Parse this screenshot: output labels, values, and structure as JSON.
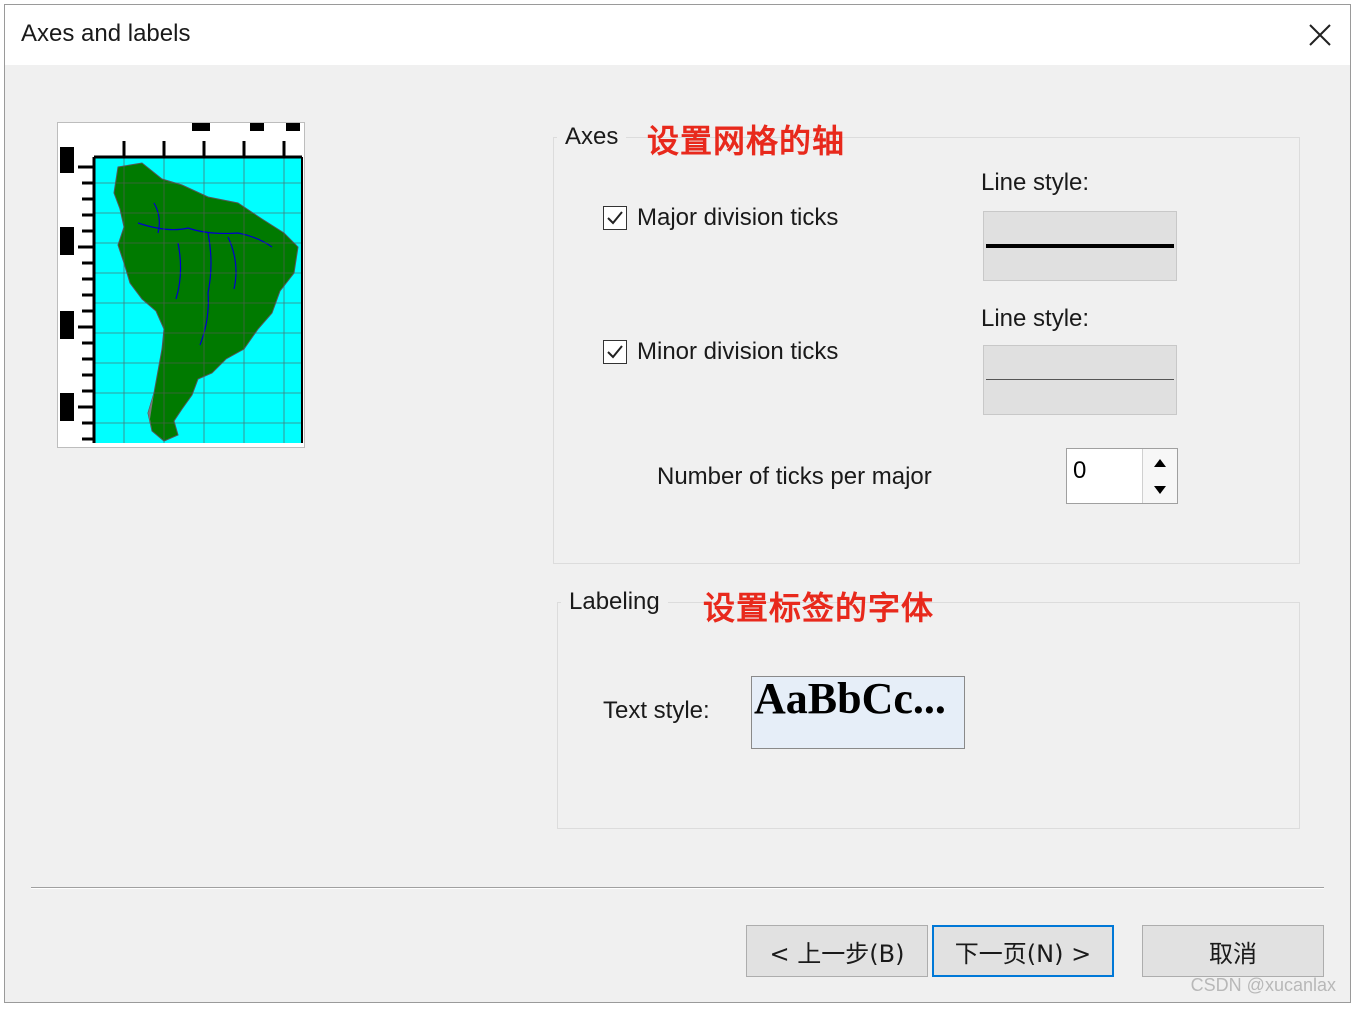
{
  "window": {
    "title": "Axes and labels"
  },
  "axes": {
    "group_label": "Axes",
    "annotation": "设置网格的轴",
    "major": {
      "label": "Major division ticks",
      "checked": true,
      "line_style_label": "Line style:"
    },
    "minor": {
      "label": "Minor division ticks",
      "checked": true,
      "line_style_label": "Line style:"
    },
    "ticks_per_major": {
      "label": "Number of ticks per major",
      "value": "0"
    }
  },
  "labeling": {
    "group_label": "Labeling",
    "annotation": "设置标签的字体",
    "text_style_label": "Text style:",
    "text_style_sample": "AaBbCc..."
  },
  "buttons": {
    "back": "< 上一步(B)",
    "next": "下一页(N) >",
    "cancel": "取消"
  },
  "watermark": "CSDN @xucanlax",
  "colors": {
    "annotation": "#e8291c",
    "map_ocean": "#00ffff",
    "map_land": "#007a00",
    "map_rivers": "#0000cc",
    "default_button_border": "#0078d7"
  }
}
